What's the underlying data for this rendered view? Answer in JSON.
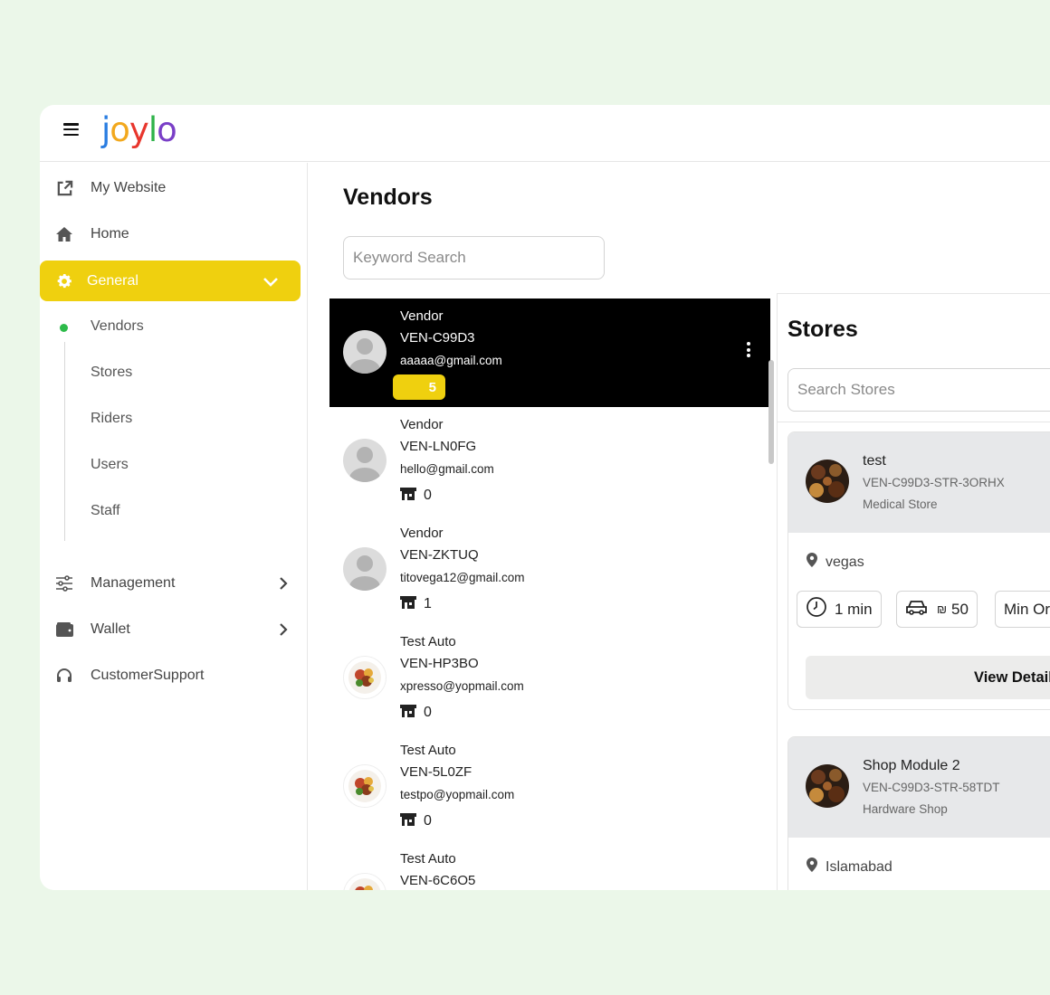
{
  "app": {
    "logo_letters": [
      {
        "ch": "j",
        "color": "#2a7de1"
      },
      {
        "ch": "o",
        "color": "#f2a81d"
      },
      {
        "ch": "y",
        "color": "#e8362d"
      },
      {
        "ch": "l",
        "color": "#2fb34a"
      },
      {
        "ch": "o",
        "color": "#7a3fc7"
      }
    ]
  },
  "sidebar": {
    "my_website": "My Website",
    "home": "Home",
    "general": "General",
    "sub_items": [
      "Vendors",
      "Stores",
      "Riders",
      "Users",
      "Staff"
    ],
    "management": "Management",
    "wallet": "Wallet",
    "customer_support": "CustomerSupport"
  },
  "main": {
    "title": "Vendors",
    "search_placeholder": "Keyword Search"
  },
  "vendors": [
    {
      "type": "Vendor",
      "code": "VEN-C99D3",
      "email": "aaaaa@gmail.com",
      "stores": "5",
      "avatar": "person",
      "selected": true
    },
    {
      "type": "Vendor",
      "code": "VEN-LN0FG",
      "email": "hello@gmail.com",
      "stores": "0",
      "avatar": "person"
    },
    {
      "type": "Vendor",
      "code": "VEN-ZKTUQ",
      "email": "titovega12@gmail.com",
      "stores": "1",
      "avatar": "person"
    },
    {
      "type": "Test Auto",
      "code": "VEN-HP3BO",
      "email": "xpresso@yopmail.com",
      "stores": "0",
      "avatar": "food"
    },
    {
      "type": "Test Auto",
      "code": "VEN-5L0ZF",
      "email": "testpo@yopmail.com",
      "stores": "0",
      "avatar": "food"
    },
    {
      "type": "Test Auto",
      "code": "VEN-6C6O5",
      "email": "",
      "stores": "",
      "avatar": "food"
    }
  ],
  "stores": {
    "title": "Stores",
    "search_placeholder": "Search Stores",
    "items": [
      {
        "name": "test",
        "code": "VEN-C99D3-STR-3ORHX",
        "type": "Medical Store",
        "location": "vegas",
        "time": "1 min",
        "currency": "₪",
        "delivery_fee": "50",
        "min_order": "Min Or",
        "view": "View Details"
      },
      {
        "name": "Shop Module 2",
        "code": "VEN-C99D3-STR-58TDT",
        "type": "Hardware Shop",
        "location": "Islamabad"
      }
    ]
  }
}
